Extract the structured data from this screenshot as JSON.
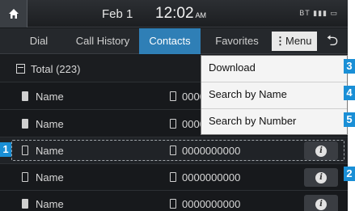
{
  "status": {
    "date": "Feb  1",
    "time": "12:02",
    "ampm": "AM",
    "indicators": "BT ▮▮▮ ▭"
  },
  "tabs": [
    {
      "label": "Dial",
      "active": false
    },
    {
      "label": "Call History",
      "active": false
    },
    {
      "label": "Contacts",
      "active": true
    },
    {
      "label": "Favorites",
      "active": false
    }
  ],
  "menu_button": {
    "label": "Menu",
    "prefix": "⋮"
  },
  "back_button": {
    "icon": "back-arrow-icon",
    "glyph": "⮌"
  },
  "total": "Total (223)",
  "contacts": [
    {
      "name": "Name",
      "number": "0000000000",
      "icon_filled": true
    },
    {
      "name": "Name",
      "number": "0000000000",
      "icon_filled": true
    },
    {
      "name": "Name",
      "number": "0000000000",
      "icon_filled": false,
      "selected": true
    },
    {
      "name": "Name",
      "number": "0000000000",
      "icon_filled": false
    },
    {
      "name": "Name",
      "number": "0000000000",
      "icon_filled": true
    }
  ],
  "menu_items": [
    "Download",
    "Search by Name",
    "Search by Number"
  ],
  "callouts": [
    "1",
    "2",
    "3",
    "4",
    "5"
  ],
  "accent_color": "#2f7fb6",
  "callout_color": "#1a8fd6"
}
